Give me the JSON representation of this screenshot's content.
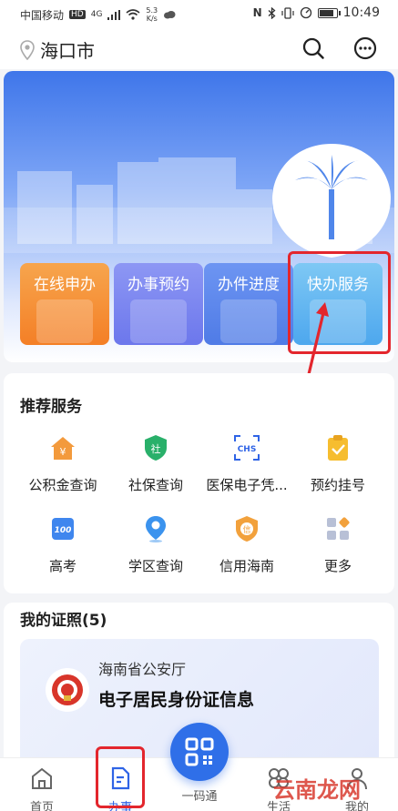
{
  "status_bar": {
    "carrier": "中国移动",
    "net_badge": "HD",
    "signal": "4G",
    "speed_value": "5.3",
    "speed_unit": "K/s",
    "time": "10:49"
  },
  "header": {
    "city": "海口市",
    "icons": [
      "location-pin-icon",
      "search-icon",
      "more-icon"
    ]
  },
  "quick_services": [
    {
      "label": "在线申办",
      "color": "#f58b31"
    },
    {
      "label": "办事预约",
      "color": "#7a84f0"
    },
    {
      "label": "办件进度",
      "color": "#5b86ec"
    },
    {
      "label": "快办服务",
      "color": "#5bb4f0"
    }
  ],
  "recommended": {
    "title": "推荐服务",
    "items": [
      {
        "label": "公积金查询",
        "icon": "house-fund-icon"
      },
      {
        "label": "社保查询",
        "icon": "social-security-shield-icon"
      },
      {
        "label": "医保电子凭...",
        "icon": "chs-medical-insurance-icon"
      },
      {
        "label": "预约挂号",
        "icon": "clipboard-check-icon"
      },
      {
        "label": "高考",
        "icon": "exam-100-icon"
      },
      {
        "label": "学区查询",
        "icon": "map-pin-icon"
      },
      {
        "label": "信用海南",
        "icon": "credit-badge-icon"
      },
      {
        "label": "更多",
        "icon": "more-grid-icon"
      }
    ]
  },
  "licenses": {
    "title": "我的证照(5)",
    "card": {
      "org": "海南省公安厅",
      "name": "电子居民身份证信息"
    }
  },
  "tabs": [
    {
      "label": "首页",
      "icon": "home-icon",
      "active": false
    },
    {
      "label": "办事",
      "icon": "document-icon",
      "active": true
    },
    {
      "label": "一码通",
      "icon": "qr-code-icon",
      "active": false
    },
    {
      "label": "生活",
      "icon": "life-circles-icon",
      "active": false
    },
    {
      "label": "我的",
      "icon": "user-icon",
      "active": false
    }
  ],
  "watermark": "云南龙网",
  "colors": {
    "accent": "#2f6fe8",
    "highlight": "#e3262d"
  }
}
